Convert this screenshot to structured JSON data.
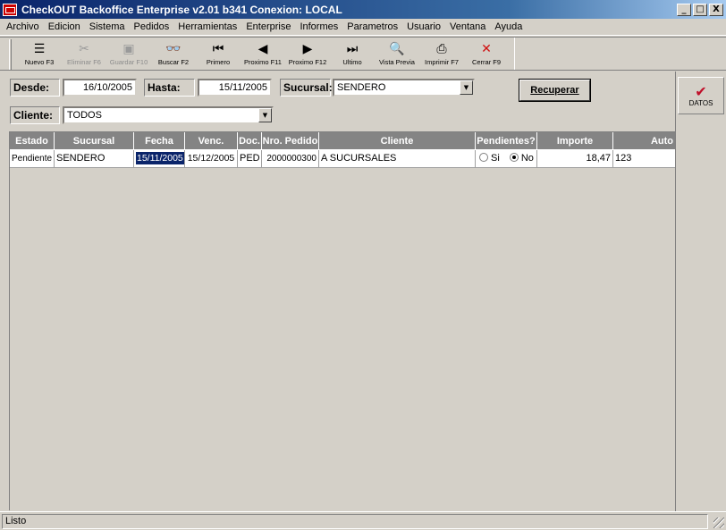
{
  "window": {
    "title": "CheckOUT Backoffice Enterprise v2.01 b341 Conexion: LOCAL",
    "min_label": "_",
    "max_label": "□",
    "close_label": "X"
  },
  "menu": [
    "Archivo",
    "Edicion",
    "Sistema",
    "Pedidos",
    "Herramientas",
    "Enterprise",
    "Informes",
    "Parametros",
    "Usuario",
    "Ventana",
    "Ayuda"
  ],
  "toolbar": [
    {
      "label": "Nuevo F3",
      "icon": "new-icon",
      "glyph": "☰",
      "enabled": true
    },
    {
      "label": "Eliminar F6",
      "icon": "delete-icon",
      "glyph": "✂",
      "enabled": false
    },
    {
      "label": "Guardar F10",
      "icon": "save-icon",
      "glyph": "▣",
      "enabled": false
    },
    {
      "label": "Buscar F2",
      "icon": "binoculars-icon",
      "glyph": "👓",
      "enabled": true
    },
    {
      "label": "Primero",
      "icon": "first-icon",
      "glyph": "⏮",
      "enabled": true
    },
    {
      "label": "Proximo F11",
      "icon": "previous-icon",
      "glyph": "◀",
      "enabled": true
    },
    {
      "label": "Proximo F12",
      "icon": "next-icon",
      "glyph": "▶",
      "enabled": true
    },
    {
      "label": "Ultimo",
      "icon": "last-icon",
      "glyph": "⏭",
      "enabled": true
    },
    {
      "label": "Vista Previa",
      "icon": "preview-icon",
      "glyph": "🔍",
      "enabled": true
    },
    {
      "label": "Imprimir F7",
      "icon": "printer-icon",
      "glyph": "⎙",
      "enabled": true
    },
    {
      "label": "Cerrar F9",
      "icon": "close-icon",
      "glyph": "✕",
      "enabled": true
    }
  ],
  "filters": {
    "desde_label": "Desde:",
    "desde_value": "16/10/2005",
    "hasta_label": "Hasta:",
    "hasta_value": "15/11/2005",
    "sucursal_label": "Sucursal:",
    "sucursal_value": "SENDERO",
    "cliente_label": "Cliente:",
    "cliente_value": "TODOS",
    "recuperar_label": "Recuperar"
  },
  "side": {
    "datos_label": "DATOS"
  },
  "grid": {
    "columns": [
      "Estado",
      "Sucursal",
      "Fecha",
      "Venc.",
      "Doc.",
      "Nro. Pedido",
      "Cliente",
      "Pendientes?",
      "Importe",
      "Auto"
    ],
    "rows": [
      {
        "estado": "Pendiente",
        "sucursal": "SENDERO",
        "fecha": "15/11/2005",
        "venc": "15/12/2005",
        "doc": "PED",
        "nro": "2000000300",
        "cliente": "A SUCURSALES",
        "pend_si": "Si",
        "pend_no": "No",
        "pend_selected": "No",
        "importe": "18,47",
        "auto": "123"
      }
    ]
  },
  "status": {
    "text": "Listo"
  },
  "colors": {
    "title_start": "#0a246a",
    "title_end": "#a6caf0",
    "header_bg": "#848484",
    "selection": "#0a246a",
    "check": "#c0102a"
  }
}
